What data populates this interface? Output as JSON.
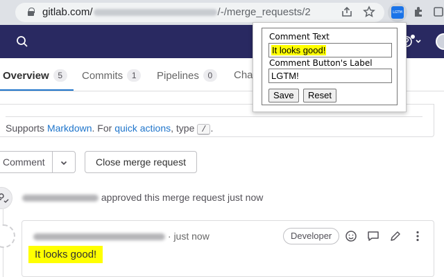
{
  "browser": {
    "url_domain": "gitlab.com/",
    "url_path": "/-/merge_requests/2",
    "extension_logo_text": "LGTM"
  },
  "tabs": [
    {
      "label": "Overview",
      "count": "5"
    },
    {
      "label": "Commits",
      "count": "1"
    },
    {
      "label": "Pipelines",
      "count": "0"
    },
    {
      "label": "Char"
    }
  ],
  "editor": {
    "supports_prefix": "Supports ",
    "markdown_link": "Markdown",
    "for_text": ". For ",
    "quick_actions_link": "quick actions",
    "type_text": ", type ",
    "slash_key": "/",
    "period": "."
  },
  "actions": {
    "comment_label": "Comment",
    "close_label": "Close merge request"
  },
  "timeline": {
    "approved_text": "approved this merge request just now",
    "note_time": "· just now",
    "role_badge": "Developer",
    "note_body": "It looks good!"
  },
  "popup": {
    "comment_text_label": "Comment Text",
    "comment_text_value": "It looks good!",
    "button_label_label": "Comment Button's Label",
    "button_label_value": "LGTM!",
    "save_label": "Save",
    "reset_label": "Reset"
  },
  "colors": {
    "header_bg": "#292961",
    "highlight": "#ffff00",
    "link": "#1f75cb"
  }
}
